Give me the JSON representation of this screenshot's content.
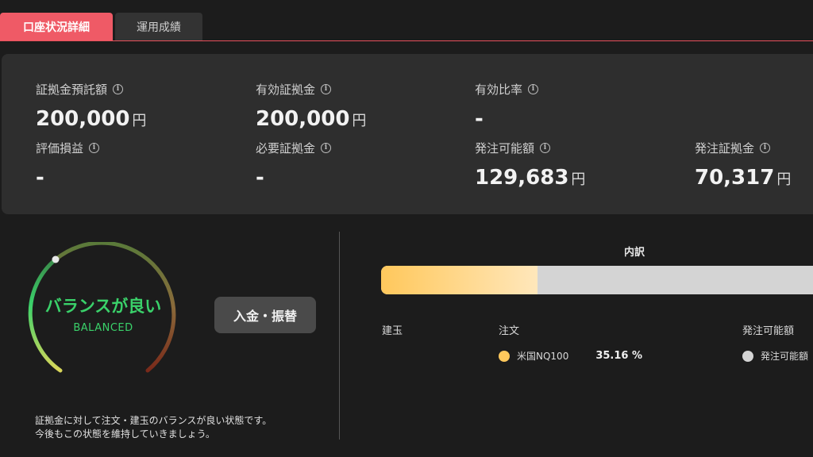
{
  "tabs": [
    {
      "label": "口座状況詳細",
      "active": true
    },
    {
      "label": "運用成績",
      "active": false
    }
  ],
  "summary": {
    "margin_deposit": {
      "label": "証拠金預託額",
      "value": "200,000",
      "unit": "円"
    },
    "effective_margin": {
      "label": "有効証拠金",
      "value": "200,000",
      "unit": "円"
    },
    "effective_ratio": {
      "label": "有効比率",
      "value": "-",
      "unit": ""
    },
    "unrealized_pl": {
      "label": "評価損益",
      "value": "-",
      "unit": ""
    },
    "required_margin": {
      "label": "必要証拠金",
      "value": "-",
      "unit": ""
    },
    "available_order": {
      "label": "発注可能額",
      "value": "129,683",
      "unit": "円"
    },
    "order_margin": {
      "label": "発注証拠金",
      "value": "70,317",
      "unit": "円"
    }
  },
  "balance_status": {
    "title_jp": "バランスが良い",
    "title_en": "BALANCED",
    "message_line1": "証拠金に対して注文・建玉のバランスが良い状態です。",
    "message_line2": "今後もこの状態を維持していきましょう。",
    "gauge_colors": [
      "#d9d65a",
      "#3ad16a",
      "#8a6a3a",
      "#7a2a1a"
    ]
  },
  "deposit_button": {
    "label": "入金・振替"
  },
  "breakdown": {
    "title": "内訳",
    "columns": [
      "建玉",
      "注文",
      "発注可能額"
    ],
    "order_fraction_percent": 35.16,
    "items": [
      {
        "name": "米国NQ100",
        "percent": "35.16 %",
        "color": "#ffc85c"
      },
      {
        "name": "発注可能額",
        "color": "#d4d4d4"
      }
    ]
  }
}
